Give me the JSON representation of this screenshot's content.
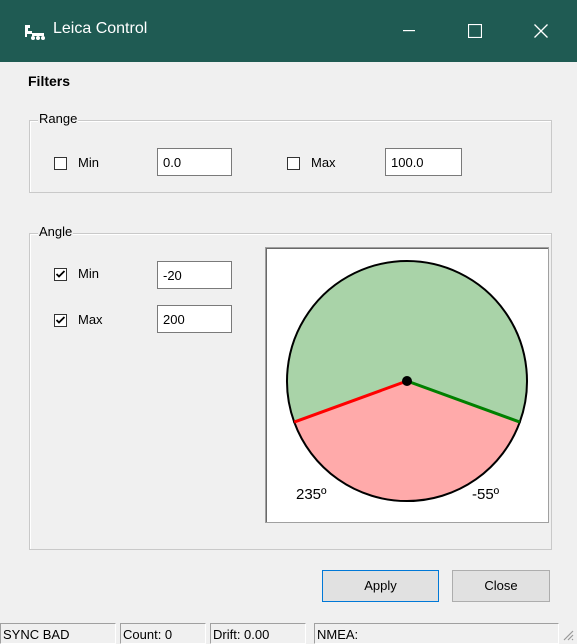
{
  "window": {
    "title": "Leica Control",
    "titlebar_color": "#1f5b53",
    "controls": {
      "minimize": "minimize-icon",
      "maximize": "maximize-icon",
      "close": "close-icon"
    }
  },
  "filters": {
    "heading": "Filters",
    "range": {
      "legend": "Range",
      "min": {
        "label": "Min",
        "checked": false,
        "value": "0.0"
      },
      "max": {
        "label": "Max",
        "checked": false,
        "value": "100.0"
      }
    },
    "angle": {
      "legend": "Angle",
      "min": {
        "label": "Min",
        "checked": true,
        "value": "-20"
      },
      "max": {
        "label": "Max",
        "checked": true,
        "value": "200"
      },
      "dial": {
        "left_label": "235º",
        "right_label": "-55º",
        "included_color": "#a9d3a8",
        "excluded_color": "#ffaaaa",
        "min_line_color": "#008000",
        "max_line_color": "#ff0000"
      }
    }
  },
  "buttons": {
    "apply": "Apply",
    "close": "Close"
  },
  "status": {
    "sync": "SYNC BAD",
    "count": "Count: 0",
    "drift": "Drift: 0.00",
    "nmea": "NMEA:"
  }
}
